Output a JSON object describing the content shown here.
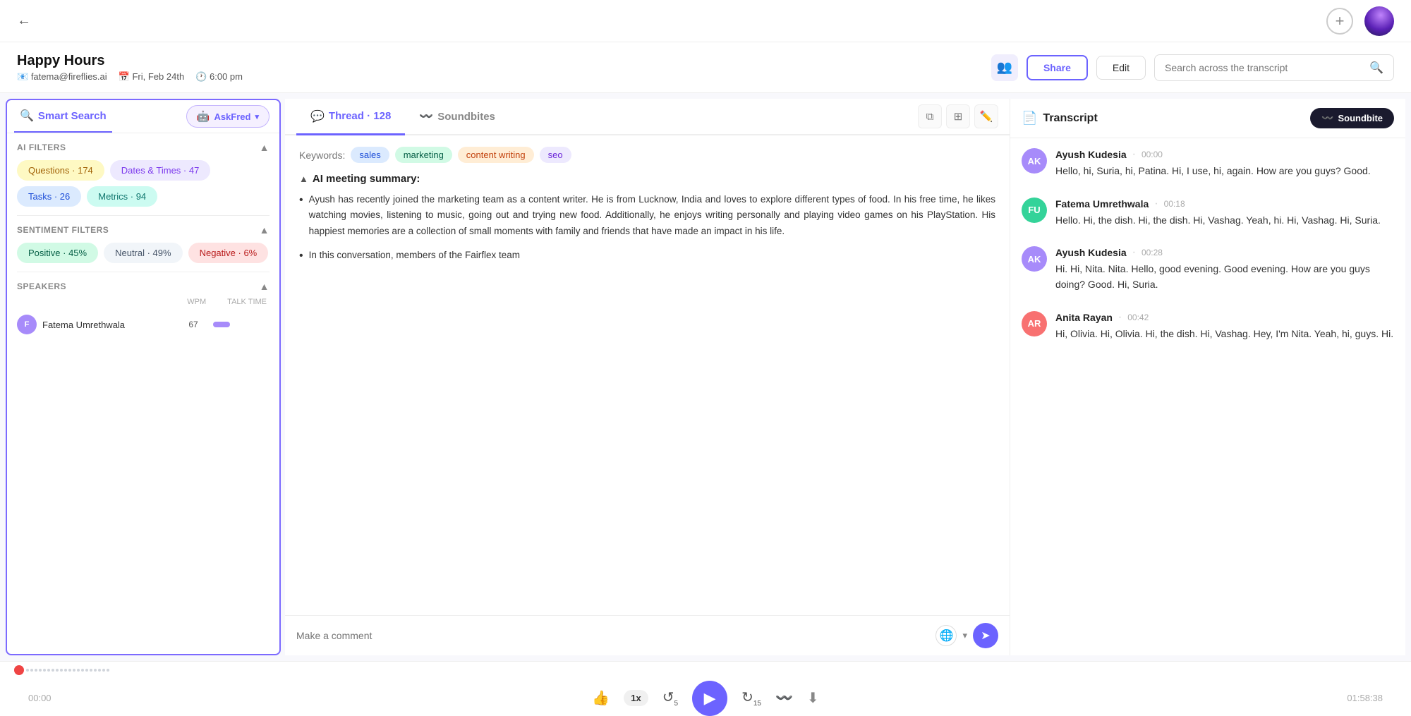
{
  "topbar": {
    "back_label": "←"
  },
  "header": {
    "title": "Happy Hours",
    "email": "fatema@fireflies.ai",
    "date": "Fri, Feb 24th",
    "time": "6:00 pm",
    "share_label": "Share",
    "edit_label": "Edit",
    "search_placeholder": "Search across the transcript"
  },
  "left_panel": {
    "smart_search_label": "Smart Search",
    "askfred_label": "AskFred",
    "ai_filters_label": "AI FILTERS",
    "filters": [
      {
        "label": "Questions · 174",
        "type": "yellow"
      },
      {
        "label": "Dates & Times · 47",
        "type": "purple"
      },
      {
        "label": "Tasks · 26",
        "type": "blue"
      },
      {
        "label": "Metrics · 94",
        "type": "teal"
      }
    ],
    "sentiment_label": "SENTIMENT FILTERS",
    "sentiments": [
      {
        "label": "Positive · 45%",
        "type": "green"
      },
      {
        "label": "Neutral · 49%",
        "type": "gray"
      },
      {
        "label": "Negative · 6%",
        "type": "red"
      }
    ],
    "speakers_label": "SPEAKERS",
    "speakers_cols": [
      "WPM",
      "TALK TIME"
    ],
    "speakers": [
      {
        "name": "Fatema Umrethwala",
        "wpm": "67",
        "talk_pct": 30,
        "color": "#a78bfa"
      }
    ]
  },
  "mid_panel": {
    "thread_label": "Thread",
    "thread_count": "128",
    "soundbites_label": "Soundbites",
    "keywords_label": "Keywords:",
    "keywords": [
      {
        "text": "sales",
        "type": "blue"
      },
      {
        "text": "marketing",
        "type": "green"
      },
      {
        "text": "content writing",
        "type": "orange"
      },
      {
        "text": "seo",
        "type": "purple"
      }
    ],
    "summary_title": "AI meeting summary:",
    "summary_items": [
      "Ayush has recently joined the marketing team as a content writer. He is from Lucknow, India and loves to explore different types of food. In his free time, he likes watching movies, listening to music, going out and trying new food. Additionally, he enjoys writing personally and playing video games on his PlayStation. His happiest memories are a collection of small moments with family and friends that have made an impact in his life.",
      "In this conversation, members of the Fairflex team"
    ],
    "comment_placeholder": "Make a comment"
  },
  "right_panel": {
    "transcript_label": "Transcript",
    "soundbite_label": "Soundbite",
    "entries": [
      {
        "name": "Ayush Kudesia",
        "time": "00:00",
        "text": "Hello, hi, Suria, hi, Patina. Hi, I use, hi, again. How are you guys? Good.",
        "color": "#a78bfa",
        "initials": "AK"
      },
      {
        "name": "Fatema Umrethwala",
        "time": "00:18",
        "text": "Hello. Hi, the dish. Hi, the dish. Hi, Vashag. Yeah, hi. Hi, Vashag. Hi, Suria.",
        "color": "#34d399",
        "initials": "FU"
      },
      {
        "name": "Ayush Kudesia",
        "time": "00:28",
        "text": "Hi. Hi, Nita. Nita. Hello, good evening. Good evening. How are you guys doing? Good. Hi, Suria.",
        "color": "#a78bfa",
        "initials": "AK"
      },
      {
        "name": "Anita Rayan",
        "time": "00:42",
        "text": "Hi, Olivia. Hi, Olivia. Hi, the dish. Hi, Vashag. Hey, I'm Nita. Yeah, hi, guys. Hi.",
        "color": "#f87171",
        "initials": "AR"
      }
    ]
  },
  "bottom_bar": {
    "time_start": "00:00",
    "time_end": "01:58:38"
  }
}
